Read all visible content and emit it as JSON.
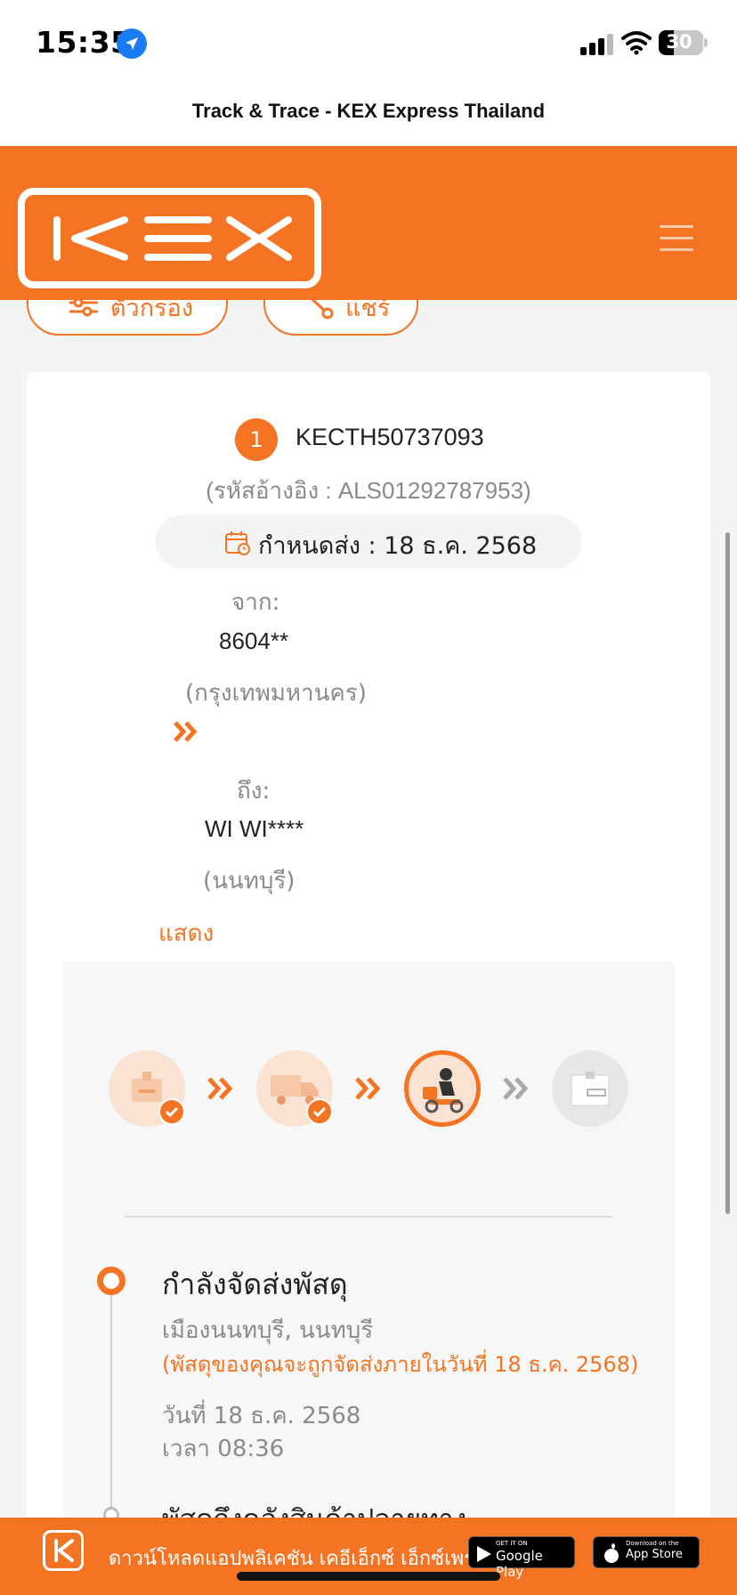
{
  "status_bar": {
    "time": "15:35",
    "battery": "30"
  },
  "page": {
    "title": "Track & Trace - KEX Express Thailand"
  },
  "header": {
    "logo_text": "KEX"
  },
  "actions": {
    "filter_label": "ตัวกรอง",
    "share_label": "แชร์"
  },
  "shipment": {
    "index": "1",
    "tracking_number": "KECTH50737093",
    "reference": "(รหัสอ้างอิง : ALS01292787953)",
    "due_date": "กำหนดส่ง : 18 ธ.ค. 2568",
    "from_label": "จาก:",
    "from_code": "8604**",
    "from_city": "(กรุงเทพมหานคร)",
    "to_label": "ถึง:",
    "to_name": "WI WI****",
    "to_city": "(นนทบุรี)",
    "show_link": "แสดง"
  },
  "progress": {
    "steps": [
      {
        "icon": "parcel-icon",
        "state": "done"
      },
      {
        "icon": "truck-icon",
        "state": "done"
      },
      {
        "icon": "delivery-rider-icon",
        "state": "active"
      },
      {
        "icon": "delivered-box-icon",
        "state": "pending"
      }
    ]
  },
  "timeline": {
    "current": {
      "title": "กำลังจัดส่งพัสดุ",
      "place": "เมืองนนทบุรี, นนทบุรี",
      "note": "(พัสดุของคุณจะถูกจัดส่งภายในวันที่ 18 ธ.ค. 2568)",
      "date": "วันที่ 18 ธ.ค. 2568",
      "time": "เวลา 08:36"
    },
    "next_title": "พัสดุถึงคลังสินค้าปลายทาง"
  },
  "banner": {
    "text": "ดาวน์โหลดแอปพลิเคชัน เคอีเอ็กซ์ เอ็กซ์เพรส",
    "google_small": "GET IT ON",
    "google_big": "Google Play",
    "apple_small": "Download on the",
    "apple_big": "App Store"
  },
  "colors": {
    "brand": "#f47424",
    "text": "#222222",
    "muted": "#8a8a8a"
  }
}
